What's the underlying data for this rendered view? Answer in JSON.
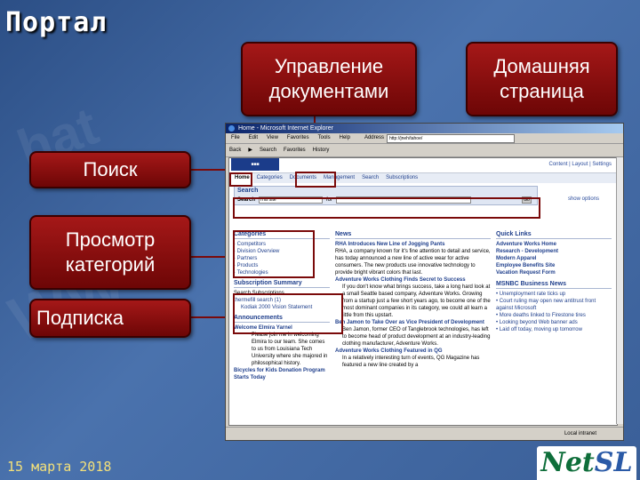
{
  "slide": {
    "title": "Портал",
    "date": "15 марта 2018",
    "logo": {
      "part1": "Net",
      "part2": "SL"
    }
  },
  "callouts": {
    "docs": "Управление документами",
    "home": "Домашняя страница",
    "search": "Поиск",
    "browse": "Просмотр категорий",
    "subscribe": "Подписка"
  },
  "colors": {
    "callout": "#8b0a0a",
    "connector": "#7a0a0a",
    "date": "#f3e07a"
  },
  "browser": {
    "title": "Home - Microsoft Internet Explorer",
    "menu": [
      "File",
      "Edit",
      "View",
      "Favorites",
      "Tools",
      "Help"
    ],
    "address_label": "Address",
    "address_value": "http://jneh/tahoe/",
    "toolbar": [
      "Back",
      "Search",
      "Favorites",
      "History"
    ],
    "status_zone": "Local intranet"
  },
  "portal": {
    "top_links": "Content | Layout | Settings",
    "tabs": [
      "Home",
      "Categories",
      "Documents",
      "Management",
      "Search",
      "Subscriptions"
    ],
    "search": {
      "label": "Search",
      "field_label": "Search",
      "scope": "This site",
      "for": "for",
      "go": "Go",
      "show_options": "show options"
    },
    "categories": {
      "heading": "Categories",
      "items": [
        "Competitors",
        "Division Overview",
        "Partners",
        "Products",
        "Technologies"
      ]
    },
    "subscriptions": {
      "heading": "Subscription Summary",
      "items": [
        "Search Subscriptions",
        "thermefill search (1)",
        "Kodiak 2000 Vision Statement"
      ]
    },
    "announcements": {
      "heading": "Announcements",
      "items": [
        {
          "title": "Welcome Elmira Yarnel",
          "body": "Please join me in welcoming Elmira to our team. She comes to us from Louisiana Tech University where she majored in philosophical history."
        },
        {
          "title": "Bicycles for Kids Donation Program Starts Today",
          "body": ""
        }
      ]
    },
    "news": {
      "heading": "News",
      "items": [
        {
          "title": "RHA Introduces New Line of Jogging Pants",
          "body": "RHA, a company known for it's fine attention to detail and service, has today announced a new line of active wear for active consumers. The new products use innovative technology to provide bright vibrant colors that last."
        },
        {
          "title": "Adventure Works Clothing Finds Secret to Success",
          "body": "If you don't know what brings success, take a long hard look at a small Seattle based company, Adventure Works. Growing from a startup just a few short years ago, to become one of the most dominant companies in its category, we could all learn a little from this upstart."
        },
        {
          "title": "Ben Jamon to Take Over as Vice President of Development",
          "body": "Ben Jamon, former CEO of Tanglebrook technologies, has left to become head of product development at an industry-leading clothing manufacturer, Adventure Works."
        },
        {
          "title": "Adventure Works Clothing Featured in QG",
          "body": "In a relatively interesting turn of events, QG Magazine has featured a new line created by a"
        }
      ]
    },
    "quick_links": {
      "heading": "Quick Links",
      "items": [
        "Adventure Works Home",
        "Research - Development",
        "Modern Apparel",
        "Employee Benefits Site",
        "Vacation Request Form"
      ]
    },
    "msnbc": {
      "heading": "MSNBC Business News",
      "items": [
        "Unemployment rate ticks up",
        "Court ruling may open new antitrust front against Microsoft",
        "More deaths linked to Firestone tires",
        "Looking beyond Web banner ads",
        "Laid off today, moving up tomorrow"
      ]
    }
  }
}
